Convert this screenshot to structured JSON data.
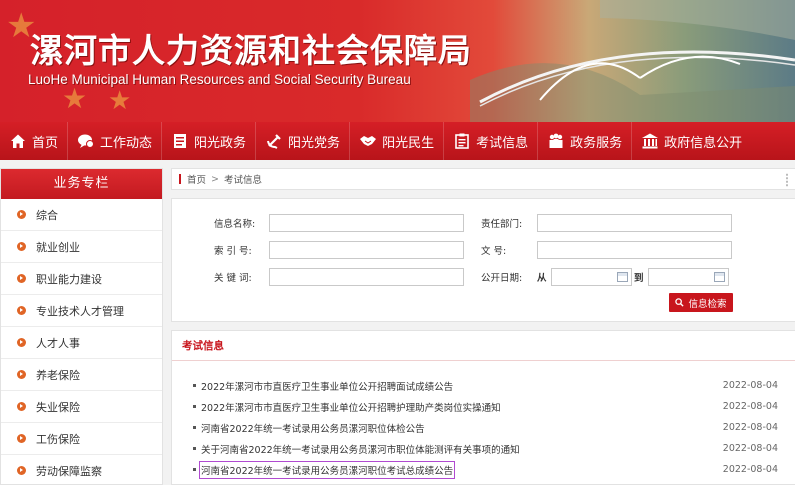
{
  "header": {
    "title_cn": "漯河市人力资源和社会保障局",
    "title_en": "LuoHe Municipal Human Resources and Social Security Bureau"
  },
  "nav": {
    "items": [
      {
        "label": "首页",
        "icon": "home-icon"
      },
      {
        "label": "工作动态",
        "icon": "chat-icon"
      },
      {
        "label": "阳光政务",
        "icon": "document-icon"
      },
      {
        "label": "阳光党务",
        "icon": "party-icon"
      },
      {
        "label": "阳光民生",
        "icon": "handshake-icon"
      },
      {
        "label": "考试信息",
        "icon": "clipboard-icon"
      },
      {
        "label": "政务服务",
        "icon": "people-icon"
      },
      {
        "label": "政府信息公开",
        "icon": "building-icon"
      }
    ]
  },
  "sidebar": {
    "title": "业务专栏",
    "items": [
      {
        "label": "综合"
      },
      {
        "label": "就业创业"
      },
      {
        "label": "职业能力建设"
      },
      {
        "label": "专业技术人才管理"
      },
      {
        "label": "人才人事"
      },
      {
        "label": "养老保险"
      },
      {
        "label": "失业保险"
      },
      {
        "label": "工伤保险"
      },
      {
        "label": "劳动保障监察"
      }
    ]
  },
  "breadcrumb": {
    "home": "首页",
    "separator": ">",
    "current": "考试信息"
  },
  "search": {
    "info_name_label": "信息名称:",
    "info_name_value": "",
    "dept_label": "责任部门:",
    "dept_value": "",
    "index_label": "索 引 号:",
    "index_value": "",
    "doc_label": "文    号:",
    "doc_value": "",
    "keyword_label": "关 键 词:",
    "keyword_value": "",
    "date_label": "公开日期:",
    "from_label": "从",
    "to_label": "到",
    "from_value": "",
    "to_value": "",
    "button_label": "信息检索"
  },
  "news": {
    "heading": "考试信息",
    "items": [
      {
        "title": "2022年漯河市市直医疗卫生事业单位公开招聘面试成绩公告",
        "date": "2022-08-04"
      },
      {
        "title": "2022年漯河市市直医疗卫生事业单位公开招聘护理助产类岗位实操通知",
        "date": "2022-08-04"
      },
      {
        "title": "河南省2022年统一考试录用公务员漯河职位体检公告",
        "date": "2022-08-04"
      },
      {
        "title": "关于河南省2022年统一考试录用公务员漯河市职位体能测评有关事项的通知",
        "date": "2022-08-04"
      },
      {
        "title": "河南省2022年统一考试录用公务员漯河职位考试总成绩公告",
        "date": "2022-08-04"
      }
    ]
  },
  "colors": {
    "brand_red": "#c8161d",
    "accent_orange": "#e06526",
    "highlight_purple": "#b04ad0"
  }
}
